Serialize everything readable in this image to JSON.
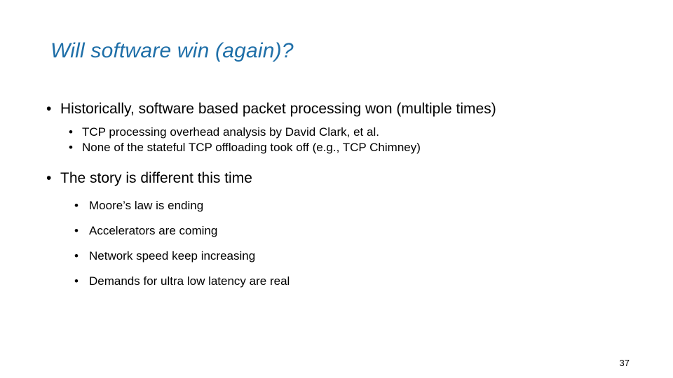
{
  "slide": {
    "title": "Will software win (again)?",
    "title_color": "#1F6FA8",
    "page_number": "37",
    "bullet_marker": "•",
    "body": {
      "section_one": {
        "main": "Historically, software based packet processing won (multiple times)",
        "subs": [
          "TCP processing overhead analysis by David Clark, et al.",
          "None of the stateful TCP offloading took off (e.g., TCP Chimney)"
        ]
      },
      "section_two": {
        "main": "The story is different this time",
        "subs": [
          "Moore’s law is ending",
          "Accelerators are coming",
          "Network speed keep increasing",
          "Demands for ultra low latency are real"
        ]
      }
    }
  }
}
